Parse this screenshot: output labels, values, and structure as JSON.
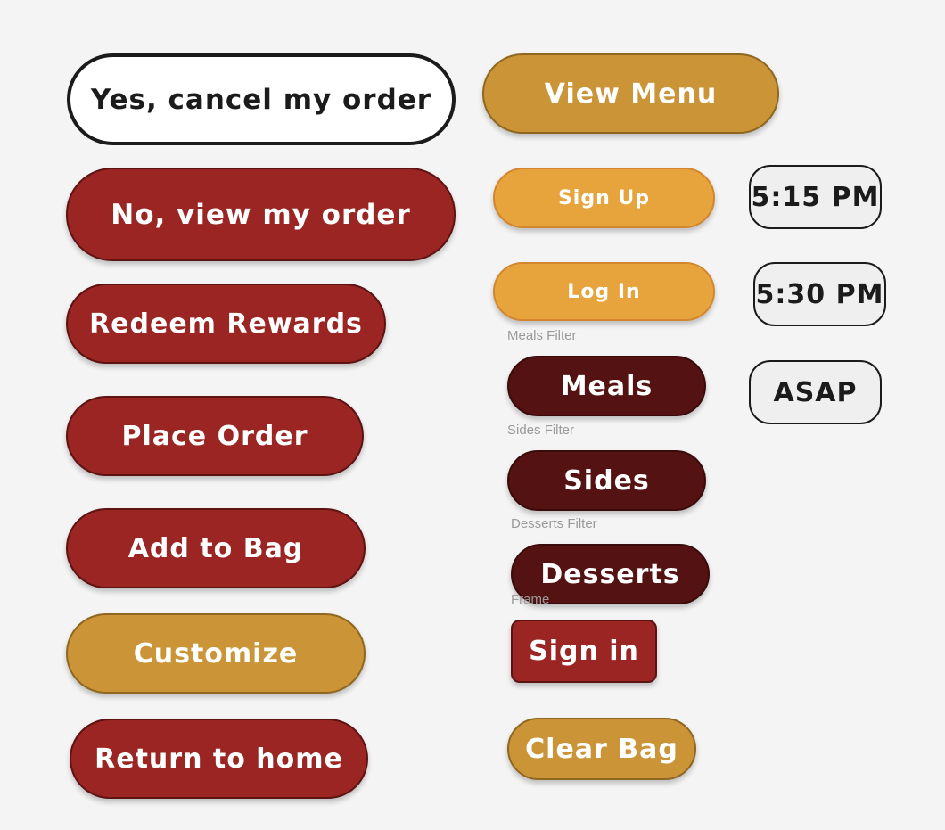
{
  "buttons": {
    "cancel_order": "Yes, cancel my order",
    "view_menu": "View Menu",
    "view_order": "No, view my order",
    "sign_up": "Sign Up",
    "time_515": "5:15 PM",
    "log_in": "Log In",
    "time_530": "5:30 PM",
    "redeem_rewards": "Redeem Rewards",
    "meals": "Meals",
    "asap": "ASAP",
    "place_order": "Place Order",
    "sides": "Sides",
    "add_to_bag": "Add to Bag",
    "desserts": "Desserts",
    "customize": "Customize",
    "sign_in": "Sign in",
    "return_home": "Return to home",
    "clear_bag": "Clear Bag"
  },
  "labels": {
    "meals_filter": "Meals Filter",
    "sides_filter": "Sides Filter",
    "desserts_filter": "Desserts Filter",
    "frame": "Frame"
  },
  "colors": {
    "red": "#9b2522",
    "gold": "#cb9537",
    "amber": "#e8a43c",
    "maroon": "#541212",
    "background": "#f4f4f4"
  }
}
